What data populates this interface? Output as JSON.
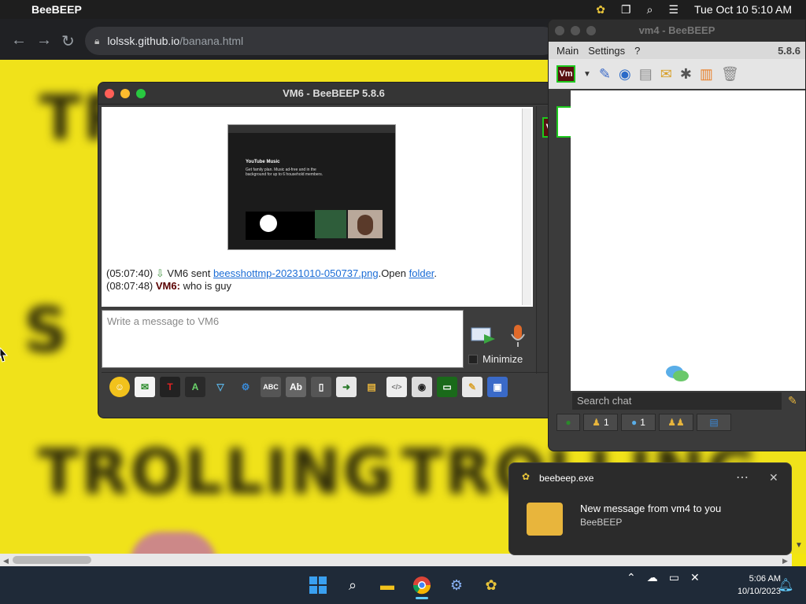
{
  "menubar": {
    "app_name": "BeeBEEP",
    "datetime": "Tue Oct 10  5:10 AM"
  },
  "browser": {
    "url_host": "lolssk.github.io",
    "url_path": "/banana.html"
  },
  "page_background": {
    "words": [
      "TROLLING",
      "TROLLING"
    ]
  },
  "vm6_window": {
    "title": "VM6 - BeeBEEP 5.8.6",
    "user_badge": "Vm",
    "messages": [
      {
        "time": "(05:07:40)",
        "prefix": "VM6 sent ",
        "file": "beesshottmp-20231010-050737.png",
        "mid": ".Open ",
        "folder": "folder",
        "end": "."
      },
      {
        "time": "(08:07:48)",
        "sender": "VM6:",
        "text": " who is guy"
      }
    ],
    "input_placeholder": "Write a message to VM6",
    "minimize_label": "Minimize",
    "screenshot_caption": "YouTube Music",
    "screenshot_text": "Get family plan. Music ad-free and in the background for up to 6 household members."
  },
  "vm4_window": {
    "title": "vm4 - BeeBEEP",
    "menu": [
      "Main",
      "Settings",
      "?"
    ],
    "version": "5.8.6",
    "user_badge": "Vm",
    "search_placeholder": "Search chat",
    "tabs": [
      {
        "icon": "users-icon",
        "count": "1"
      },
      {
        "icon": "chat-icon",
        "count": "1"
      },
      {
        "icon": "groups-icon",
        "count": ""
      },
      {
        "icon": "files-icon",
        "count": ""
      }
    ]
  },
  "notification": {
    "app": "beebeep.exe",
    "title": "New message from vm4 to you",
    "subtitle": "BeeBEEP"
  },
  "taskbar": {
    "time": "5:06 AM",
    "date": "10/10/2023"
  }
}
